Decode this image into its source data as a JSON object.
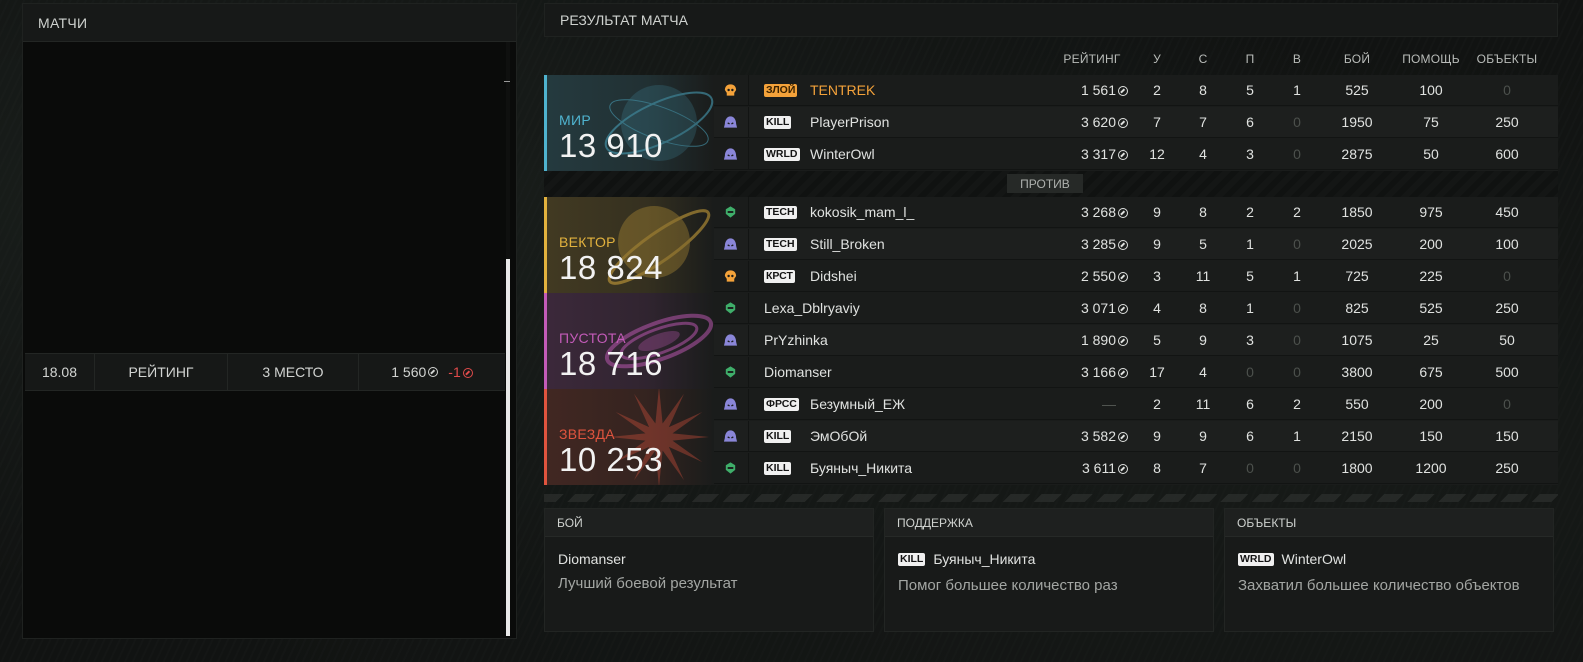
{
  "matches": {
    "title": "МАТЧИ",
    "rows": [
      {
        "date": "18.08",
        "type": "РЕЙТИНГ",
        "place": "3 МЕСТО",
        "rating": "1 560",
        "delta": "-1"
      }
    ]
  },
  "result": {
    "title": "РЕЗУЛЬТАТ МАТЧА",
    "columns": {
      "rating": "РЕЙТИНГ",
      "u": "У",
      "s": "С",
      "p": "П",
      "v": "В",
      "fight": "БОЙ",
      "help": "ПОМОЩЬ",
      "objects": "ОБЪЕКТЫ"
    },
    "vs_label": "ПРОТИВ",
    "teams": [
      {
        "name": "МИР",
        "score": "13 910",
        "color": "#4fb3cf",
        "emblem": "globe-emblem",
        "players": [
          {
            "rank_icon": "skull-icon",
            "rank_color": "#f4a23a",
            "tag": "ЗЛОЙ",
            "tag_style": "orange",
            "name": "TENTREK",
            "name_style": "orange",
            "rating": "1 561",
            "u": "2",
            "s": "8",
            "p": "5",
            "v": "1",
            "fight": "525",
            "help": "100",
            "objects": "0"
          },
          {
            "rank_icon": "hood-icon",
            "rank_color": "#8a86d8",
            "tag": "KILL",
            "name": "PlayerPrison",
            "rating": "3 620",
            "u": "7",
            "s": "7",
            "p": "6",
            "v": "0",
            "fight": "1950",
            "help": "75",
            "objects": "250"
          },
          {
            "rank_icon": "hood-icon",
            "rank_color": "#8a86d8",
            "tag": "WRLD",
            "name": "WinterOwl",
            "rating": "3 317",
            "u": "12",
            "s": "4",
            "p": "3",
            "v": "0",
            "fight": "2875",
            "help": "50",
            "objects": "600"
          }
        ]
      },
      {
        "name": "ВЕКТОР",
        "score": "18 824",
        "color": "#e2b23e",
        "emblem": "planet-emblem",
        "players": [
          {
            "rank_icon": "helmet-icon",
            "rank_color": "#3fae6a",
            "tag": "TECH",
            "name": "kokosik_mam_l_",
            "rating": "3 268",
            "u": "9",
            "s": "8",
            "p": "2",
            "v": "2",
            "fight": "1850",
            "help": "975",
            "objects": "450"
          },
          {
            "rank_icon": "hood-icon",
            "rank_color": "#8a86d8",
            "tag": "TECH",
            "name": "Still_Broken",
            "rating": "3 285",
            "u": "9",
            "s": "5",
            "p": "1",
            "v": "0",
            "fight": "2025",
            "help": "200",
            "objects": "100"
          },
          {
            "rank_icon": "skull-icon",
            "rank_color": "#f4a23a",
            "tag": "КРСТ",
            "name": "Didshei",
            "rating": "2 550",
            "u": "3",
            "s": "11",
            "p": "5",
            "v": "1",
            "fight": "725",
            "help": "225",
            "objects": "0"
          }
        ]
      },
      {
        "name": "ПУСТОТА",
        "score": "18 716",
        "color": "#c35bb8",
        "emblem": "vortex-emblem",
        "players": [
          {
            "rank_icon": "helmet-icon",
            "rank_color": "#3fae6a",
            "tag": "",
            "name": "Lexa_Dblryaviy",
            "rating": "3 071",
            "u": "4",
            "s": "8",
            "p": "1",
            "v": "0",
            "fight": "825",
            "help": "525",
            "objects": "250"
          },
          {
            "rank_icon": "hood-icon",
            "rank_color": "#8a86d8",
            "tag": "",
            "name": "PrYzhinka",
            "rating": "1 890",
            "u": "5",
            "s": "9",
            "p": "3",
            "v": "0",
            "fight": "1075",
            "help": "25",
            "objects": "50"
          },
          {
            "rank_icon": "helmet-icon",
            "rank_color": "#3fae6a",
            "tag": "",
            "name": "Diomanser",
            "rating": "3 166",
            "u": "17",
            "s": "4",
            "p": "0",
            "v": "0",
            "fight": "3800",
            "help": "675",
            "objects": "500"
          }
        ]
      },
      {
        "name": "ЗВЕЗДА",
        "score": "10 253",
        "color": "#e0543e",
        "emblem": "star-emblem",
        "players": [
          {
            "rank_icon": "hood-icon",
            "rank_color": "#8a86d8",
            "tag": "ФРСС",
            "name": "Безумный_ЕЖ",
            "rating": "—",
            "u": "2",
            "s": "11",
            "p": "6",
            "v": "2",
            "fight": "550",
            "help": "200",
            "objects": "0"
          },
          {
            "rank_icon": "hood-icon",
            "rank_color": "#8a86d8",
            "tag": "KILL",
            "name": "ЭмОбОй",
            "rating": "3 582",
            "u": "9",
            "s": "9",
            "p": "6",
            "v": "1",
            "fight": "2150",
            "help": "150",
            "objects": "150"
          },
          {
            "rank_icon": "helmet-icon",
            "rank_color": "#3fae6a",
            "tag": "KILL",
            "name": "Буяныч_Никита",
            "rating": "3 611",
            "u": "8",
            "s": "7",
            "p": "0",
            "v": "0",
            "fight": "1800",
            "help": "1200",
            "objects": "250"
          }
        ]
      }
    ]
  },
  "awards": [
    {
      "title": "БОЙ",
      "tag": "",
      "player": "Diomanser",
      "desc": "Лучший боевой результат"
    },
    {
      "title": "ПОДДЕРЖКА",
      "tag": "KILL",
      "player": "Буяныч_Никита",
      "desc": "Помог большее количество раз"
    },
    {
      "title": "ОБЪЕКТЫ",
      "tag": "WRLD",
      "player": "WinterOwl",
      "desc": "Захватил большее количество объектов"
    }
  ]
}
